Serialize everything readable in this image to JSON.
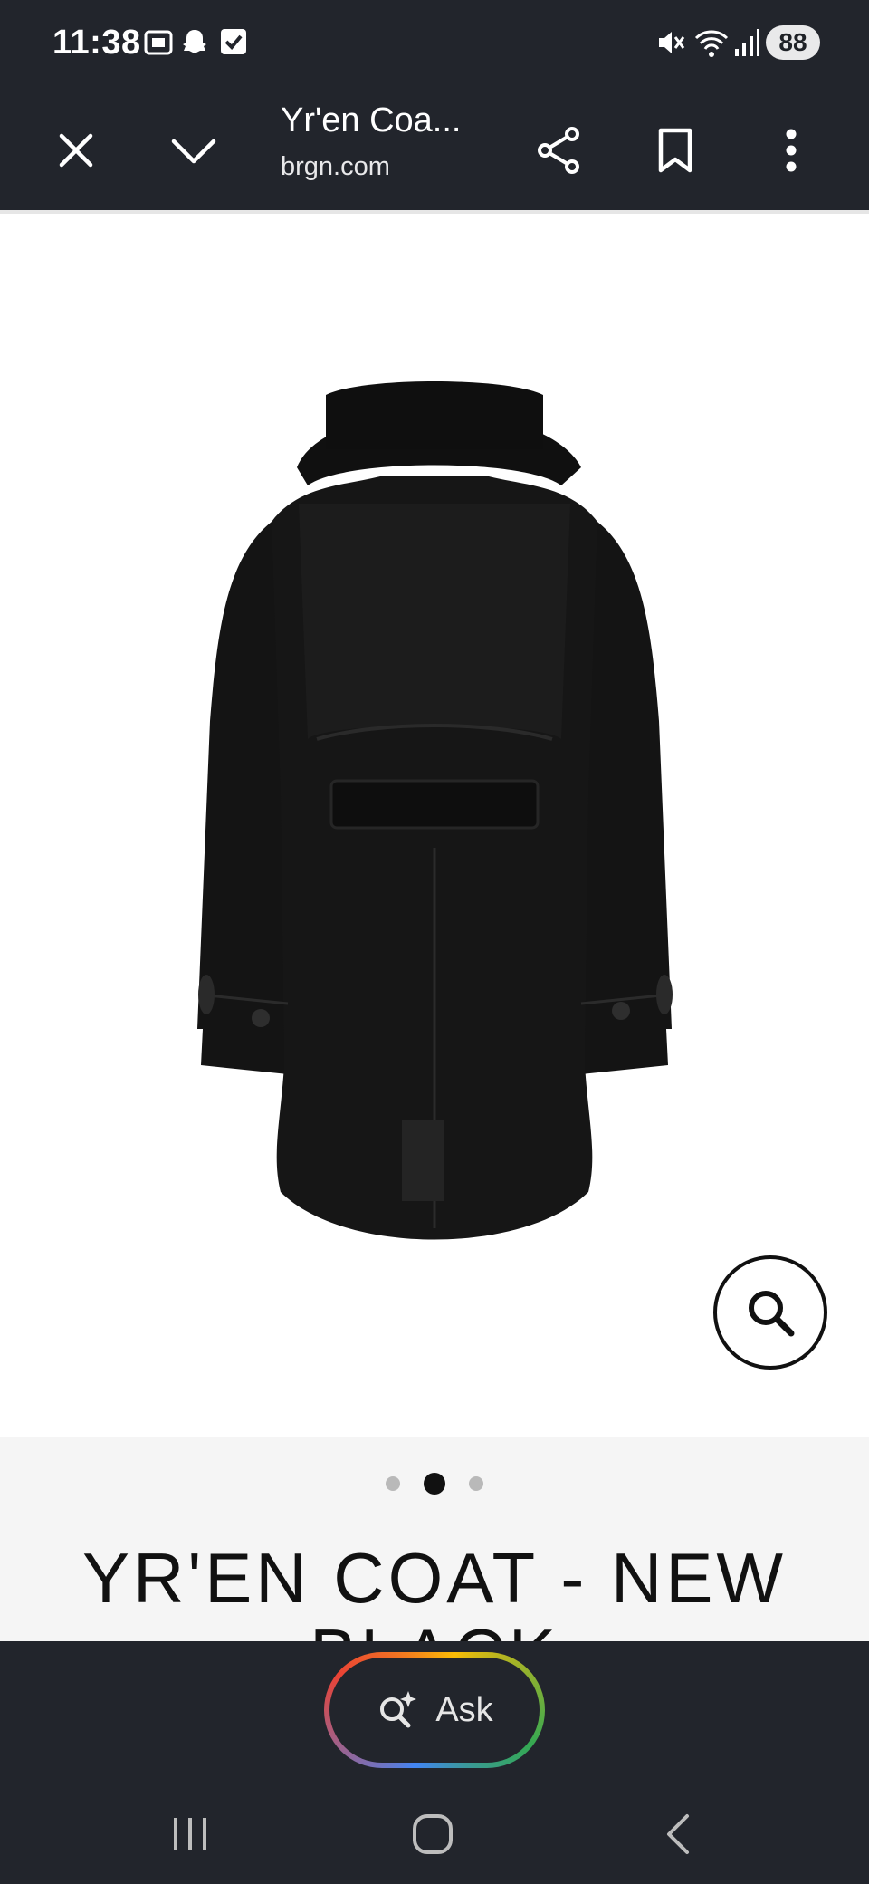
{
  "status_bar": {
    "time": "11:38",
    "battery": "88",
    "left_icons": [
      "screenshot-icon",
      "snapchat-ghost-icon",
      "checkbox-icon"
    ],
    "right_icons": [
      "mute-icon",
      "wifi-icon",
      "signal-icon"
    ]
  },
  "toolbar": {
    "title": "Yr'en Coa...",
    "url": "brgn.com",
    "icons": [
      "close-icon",
      "chevron-down-icon",
      "share-icon",
      "bookmark-icon",
      "more-vert-icon"
    ]
  },
  "gallery": {
    "dots": 3,
    "active_index": 1
  },
  "product": {
    "title": "YR'EN COAT - NEW BLACK"
  },
  "ask": {
    "label": "Ask"
  },
  "nav": {
    "icons": [
      "recents-icon",
      "home-icon",
      "back-icon"
    ]
  },
  "colors": {
    "chrome": "#22252c",
    "band": "#f5f5f5",
    "dot_active": "#111111",
    "dot_inactive": "#b9b9b9"
  }
}
